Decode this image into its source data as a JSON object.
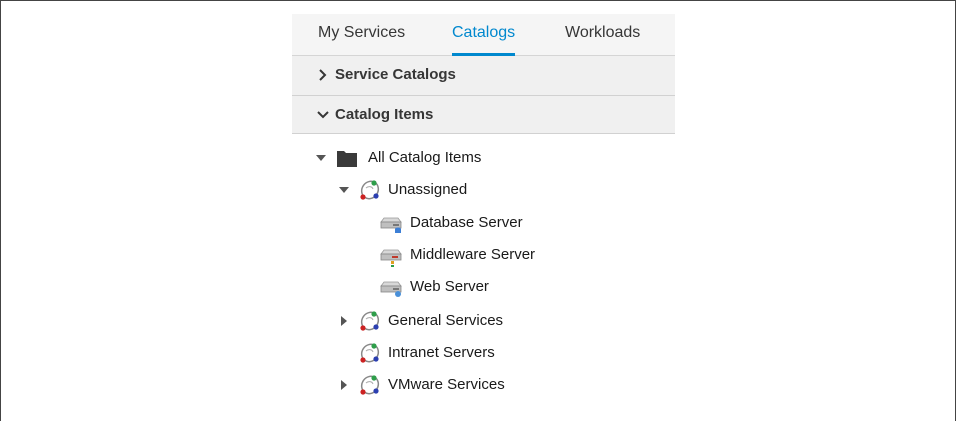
{
  "tabs": [
    {
      "label": "My Services",
      "active": false
    },
    {
      "label": "Catalogs",
      "active": true
    },
    {
      "label": "Workloads",
      "active": false
    }
  ],
  "accordions": {
    "service_catalogs": {
      "label": "Service Catalogs",
      "expanded": false,
      "chevron": "chevron-right-icon"
    },
    "catalog_items": {
      "label": "Catalog Items",
      "expanded": true,
      "chevron": "chevron-down-icon"
    }
  },
  "tree": {
    "root": {
      "label": "All Catalog Items",
      "icon": "folder-icon",
      "expanded": true
    },
    "unassigned": {
      "label": "Unassigned",
      "icon": "catalog-icon",
      "expanded": true
    },
    "items": [
      {
        "label": "Database Server",
        "icon": "server-icon"
      },
      {
        "label": "Middleware Server",
        "icon": "server-icon"
      },
      {
        "label": "Web Server",
        "icon": "server-icon"
      }
    ],
    "catalogs": [
      {
        "label": "General Services",
        "icon": "catalog-icon",
        "expandable": true
      },
      {
        "label": "Intranet Servers",
        "icon": "catalog-icon",
        "expandable": false
      },
      {
        "label": "VMware Services",
        "icon": "catalog-icon",
        "expandable": true
      }
    ]
  },
  "colors": {
    "accent": "#0088ce",
    "panel_bg": "#f5f5f5",
    "text": "#363636"
  }
}
